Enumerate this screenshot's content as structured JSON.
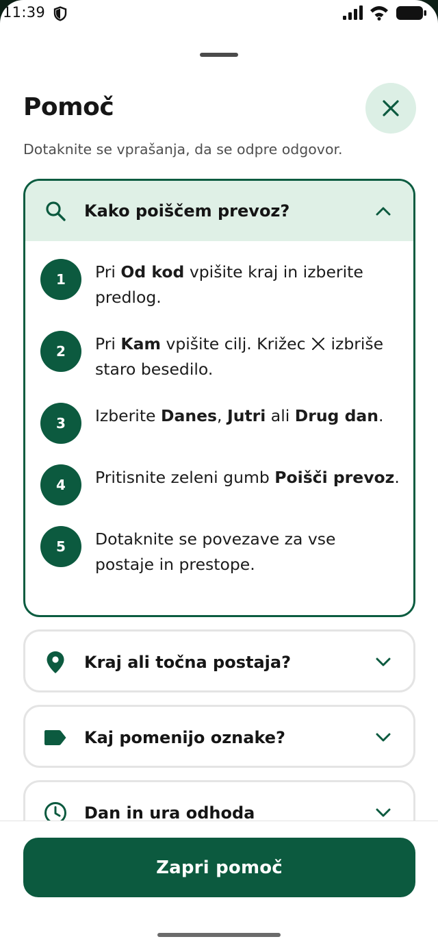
{
  "status": {
    "time": "11:39"
  },
  "sheet": {
    "title": "Pomoč",
    "subtitle": "Dotaknite se vprašanja, da se odpre odgovor.",
    "close_icon": "close-icon"
  },
  "faq": [
    {
      "title": "Kako poiščem prevoz?",
      "icon": "search-icon",
      "expanded": true,
      "steps": [
        {
          "number": "1",
          "parts": [
            "Pri ",
            "Od kod",
            " vpišite kraj in izberite predlog."
          ]
        },
        {
          "number": "2",
          "parts": [
            "Pri ",
            "Kam",
            " vpišite cilj. Križec ",
            "izbriše staro besedilo."
          ]
        },
        {
          "number": "3",
          "parts": [
            "Izberite ",
            "Danes",
            ", ",
            "Jutri",
            " ali ",
            "Drug dan",
            "."
          ]
        },
        {
          "number": "4",
          "parts": [
            "Pritisnite zeleni gumb ",
            "Poišči prevoz",
            "."
          ]
        },
        {
          "number": "5",
          "parts": [
            "Dotaknite se povezave za vse postaje in prestope."
          ]
        }
      ]
    },
    {
      "title": "Kraj ali točna postaja?",
      "icon": "location-pin-icon",
      "expanded": false
    },
    {
      "title": "Kaj pomenijo oznake?",
      "icon": "tag-icon",
      "expanded": false
    },
    {
      "title": "Dan in ura odhoda",
      "icon": "clock-icon",
      "expanded": false
    }
  ],
  "footer": {
    "close_label": "Zapri pomoč"
  },
  "colors": {
    "primary": "#0c5a3f",
    "primary_light": "#dff0e6",
    "close_bg": "#dcefe5"
  }
}
